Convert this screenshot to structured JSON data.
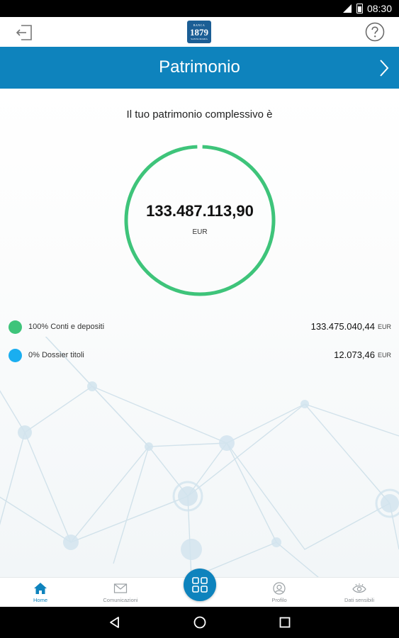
{
  "status_bar": {
    "time": "08:30",
    "icons": [
      "signal-icon",
      "battery-icon"
    ]
  },
  "app_bar": {
    "logo": {
      "top_text": "BANCA",
      "year": "1879",
      "bottom_text": "SANTA MARIA"
    },
    "left_icon": "logout-icon",
    "right_icon": "help-icon"
  },
  "title_bar": {
    "title": "Patrimonio",
    "right_icon": "chevron-right-icon"
  },
  "summary": {
    "intro": "Il tuo patrimonio complessivo è",
    "total": "133.487.113,90",
    "currency": "EUR",
    "ring_color": "#3ec47a"
  },
  "breakdown": [
    {
      "label": "100% Conti e depositi",
      "amount": "133.475.040,44",
      "currency": "EUR",
      "color": "#3ec47a",
      "share": 100
    },
    {
      "label": "0% Dossier titoli",
      "amount": "12.073,46",
      "currency": "EUR",
      "color": "#1aaef0",
      "share": 0
    }
  ],
  "bottom_nav": {
    "items": [
      {
        "label": "Home",
        "icon": "home-icon",
        "active": true
      },
      {
        "label": "Comunicazioni",
        "icon": "mail-icon",
        "active": false
      },
      {
        "label": "Profilo",
        "icon": "profile-icon",
        "active": false
      },
      {
        "label": "Dati sensibili",
        "icon": "eye-icon",
        "active": false
      }
    ],
    "center_button_icon": "grid-icon"
  },
  "system_nav": [
    "back-icon",
    "home-circle-icon",
    "recents-icon"
  ],
  "colors": {
    "accent": "#0e83bd",
    "positive": "#3ec47a",
    "secondary": "#1aaef0"
  }
}
